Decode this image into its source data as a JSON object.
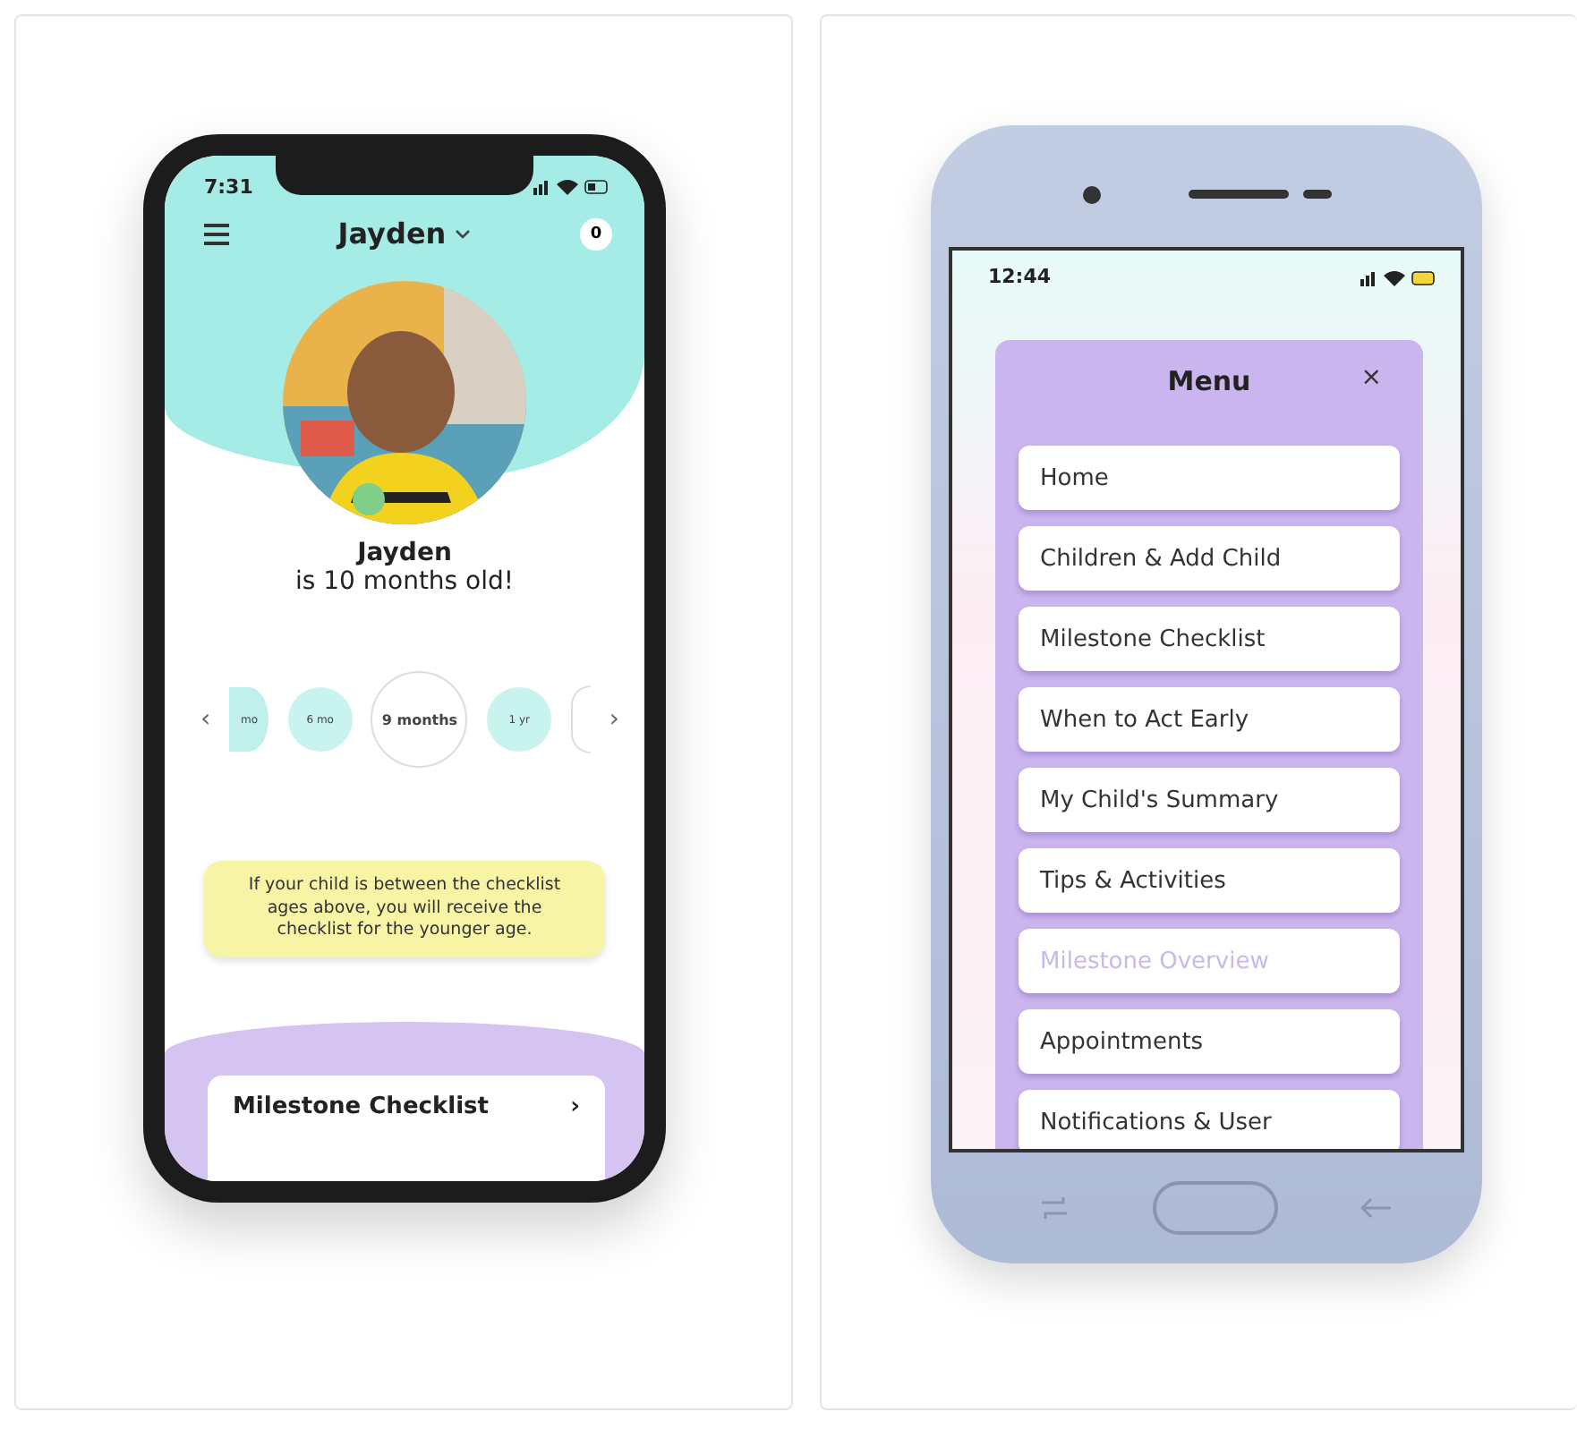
{
  "left_phone": {
    "status_time": "7:31",
    "child_name": "Jayden",
    "notification_count": "0",
    "name": "Jayden",
    "age_text": "is 10 months old!",
    "age_prev": "‹",
    "age_next": "›",
    "ages": [
      {
        "label": "mo",
        "selected": false,
        "partial": true
      },
      {
        "label": "6 mo",
        "selected": false,
        "partial": false
      },
      {
        "label": "9 months",
        "selected": true,
        "partial": false
      },
      {
        "label": "1 yr",
        "selected": false,
        "partial": false
      }
    ],
    "note": "If your child is between the checklist ages above, you will receive the checklist for the younger age.",
    "card": {
      "title": "Milestone Checklist",
      "chevron": "›"
    }
  },
  "right_phone": {
    "status_time": "12:44",
    "menu": {
      "title": "Menu",
      "close": "×",
      "items": [
        {
          "label": "Home",
          "disabled": false
        },
        {
          "label": "Children & Add Child",
          "disabled": false
        },
        {
          "label": "Milestone Checklist",
          "disabled": false
        },
        {
          "label": "When to Act Early",
          "disabled": false
        },
        {
          "label": "My Child's Summary",
          "disabled": false
        },
        {
          "label": "Tips & Activities",
          "disabled": false
        },
        {
          "label": "Milestone Overview",
          "disabled": true
        },
        {
          "label": "Appointments",
          "disabled": false
        },
        {
          "label": "Notifications & User",
          "disabled": false
        }
      ]
    }
  }
}
